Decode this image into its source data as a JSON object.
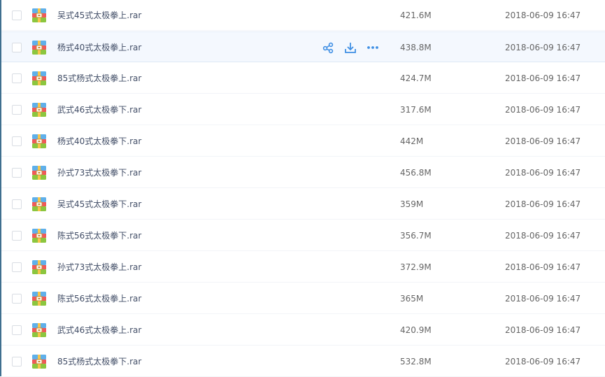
{
  "hover_actions": [
    "share-icon",
    "download-icon",
    "more-icon"
  ],
  "colors": {
    "accent": "#3f8fe4",
    "row_hover": "#f4f8fe"
  },
  "files": [
    {
      "name": "吴式45式太极拳上.rar",
      "size": "421.6M",
      "date": "2018-06-09 16:47",
      "hovered": false
    },
    {
      "name": "杨式40式太极拳上.rar",
      "size": "438.8M",
      "date": "2018-06-09 16:47",
      "hovered": true
    },
    {
      "name": "85式杨式太极拳上.rar",
      "size": "424.7M",
      "date": "2018-06-09 16:47",
      "hovered": false
    },
    {
      "name": "武式46式太极拳下.rar",
      "size": "317.6M",
      "date": "2018-06-09 16:47",
      "hovered": false
    },
    {
      "name": "杨式40式太极拳下.rar",
      "size": "442M",
      "date": "2018-06-09 16:47",
      "hovered": false
    },
    {
      "name": "孙式73式太极拳下.rar",
      "size": "456.8M",
      "date": "2018-06-09 16:47",
      "hovered": false
    },
    {
      "name": "吴式45式太极拳下.rar",
      "size": "359M",
      "date": "2018-06-09 16:47",
      "hovered": false
    },
    {
      "name": "陈式56式太极拳下.rar",
      "size": "356.7M",
      "date": "2018-06-09 16:47",
      "hovered": false
    },
    {
      "name": "孙式73式太极拳上.rar",
      "size": "372.9M",
      "date": "2018-06-09 16:47",
      "hovered": false
    },
    {
      "name": "陈式56式太极拳上.rar",
      "size": "365M",
      "date": "2018-06-09 16:47",
      "hovered": false
    },
    {
      "name": "武式46式太极拳上.rar",
      "size": "420.9M",
      "date": "2018-06-09 16:47",
      "hovered": false
    },
    {
      "name": "85式杨式太极拳下.rar",
      "size": "532.8M",
      "date": "2018-06-09 16:47",
      "hovered": false
    }
  ]
}
